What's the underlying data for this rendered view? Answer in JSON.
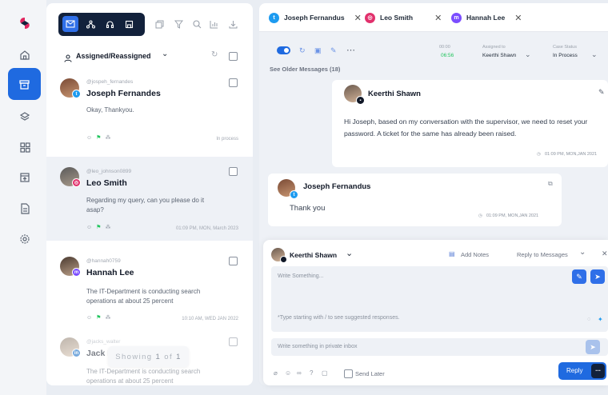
{
  "colors": {
    "accent": "#1f6ae0",
    "navy": "#12213b",
    "twitter": "#1d9bf0",
    "instagram": "#e1306c",
    "messenger": "#7b4dff",
    "linkedin": "#0a66c2",
    "green": "#22c55e"
  },
  "rail": {
    "items": [
      "home-icon",
      "inbox-icon",
      "layers-icon",
      "grid-icon",
      "upload-icon",
      "document-icon",
      "settings-icon"
    ]
  },
  "list": {
    "filter_label": "Assigned/Reassigned",
    "conversations": [
      {
        "handle": "@jospeh_fernandes",
        "name": "Joseph Fernandes",
        "message": "Okay, Thankyou.",
        "status": "In process",
        "platform": "twitter"
      },
      {
        "handle": "@leo_johnson0899",
        "name": "Leo Smith",
        "message": "Regarding my query, can you please do it asap?",
        "time": "01:09 PM, MON, March 2023",
        "platform": "instagram"
      },
      {
        "handle": "@hannah0759",
        "name": "Hannah Lee",
        "message": "The IT-Department is conducting search operations at about 25 percent",
        "time": "10:10 AM, WED JAN 2022",
        "platform": "messenger"
      },
      {
        "handle": "@jacks_walter",
        "name": "Jack N",
        "message": "The IT-Department is conducting search operations at about 25 percent",
        "platform": "linkedin"
      }
    ],
    "toast": {
      "prefix": "Showing",
      "current": "1",
      "of": "of",
      "total": "1"
    }
  },
  "tabs": [
    {
      "label": "Joseph Fernandus",
      "platform": "twitter"
    },
    {
      "label": "Leo Smith",
      "platform": "instagram"
    },
    {
      "label": "Hannah Lee",
      "platform": "messenger"
    }
  ],
  "header": {
    "timer_top": "00:00",
    "timer": "06:56",
    "assigned_label": "Assigned to",
    "assigned_value": "Keerthi Shawn",
    "status_label": "Case Status",
    "status_value": "In Process",
    "older": "See Older Messages (18)"
  },
  "messages": [
    {
      "author": "Keerthi Shawn",
      "text": "Hi Joseph, based on my conversation with the supervisor, we need to reset your password. A ticket for the same has already been raised.",
      "time": "01:09 PM, MON,JAN 2021"
    },
    {
      "author": "Joseph Fernandus",
      "text": "Thank you",
      "time": "01:09 PM, MON,JAN 2021"
    }
  ],
  "composer": {
    "agent": "Keerthi Shawn",
    "add_notes": "Add Notes",
    "reply_to": "Reply to Messages",
    "write_placeholder": "Write Something...",
    "hint": "*Type starting with / to see suggested responses.",
    "private_placeholder": "Write something in private inbox",
    "send_later": "Send Later",
    "reply": "Reply",
    "more": "..."
  }
}
